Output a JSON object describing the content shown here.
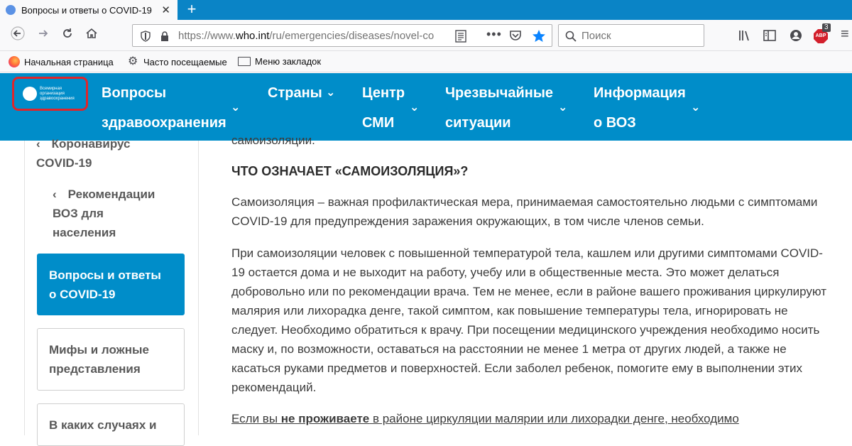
{
  "browser": {
    "tab_title": "Вопросы и ответы о COVID-19",
    "url_prefix": "https://www.",
    "url_host": "who.int",
    "url_path": "/ru/emergencies/diseases/novel-co",
    "search_placeholder": "Поиск",
    "adblock_count": "3",
    "adblock_label": "ABP",
    "bookmarks": [
      "Начальная страница",
      "Часто посещаемые",
      "Меню закладок"
    ]
  },
  "site": {
    "logo_text": "Всемирная организация здравоохранения",
    "menu": [
      {
        "line1": "Вопросы",
        "line2": "здравоохранения"
      },
      {
        "line1": "Страны",
        "line2": ""
      },
      {
        "line1": "Центр",
        "line2": "СМИ"
      },
      {
        "line1": "Чрезвычайные",
        "line2": "ситуации"
      },
      {
        "line1": "Информация",
        "line2": "о ВОЗ"
      }
    ]
  },
  "sidebar": {
    "crumb1_line1": "Коронавирус",
    "crumb1_line2": "COVID-19",
    "crumb2_line1": "Рекомендации",
    "crumb2_line2": "ВОЗ для",
    "crumb2_line3": "населения",
    "active_line1": "Вопросы и ответы",
    "active_line2": "о COVID-19",
    "card2_line1": "Мифы и ложные",
    "card2_line2": "представления",
    "card3_line1": "В каких случаях и"
  },
  "content": {
    "cut_top": "самоизоляции.",
    "heading": "ЧТО ОЗНАЧАЕТ «САМОИЗОЛЯЦИЯ»?",
    "p1": "Самоизоляция – важная профилактическая мера, принимаемая самостоятельно людьми с симптомами COVID-19 для предупреждения заражения окружающих, в том числе членов семьи.",
    "p2": "При самоизоляции человек с повышенной температурой тела, кашлем или другими симптомами COVID-19 остается дома и не выходит на работу, учебу или в общественные места.  Это может делаться добровольно или по рекомендации врача. Тем не менее, если в районе вашего проживания циркулируют малярия или лихорадка денге, такой симптом, как повышение температуры тела, игнорировать не следует.  Необходимо обратиться к врачу.  При посещении медицинского учреждения необходимо носить маску и, по возможности, оставаться на расстоянии не менее 1 метра от других людей, а также  не касаться руками предметов и поверхностей. Если заболел ребенок, помогите ему в выполнении этих рекомендаций.",
    "p3_a": "Если вы ",
    "p3_b": "не проживаете",
    "p3_c": " в районе циркуляции малярии или лихорадки денге, необходимо"
  }
}
